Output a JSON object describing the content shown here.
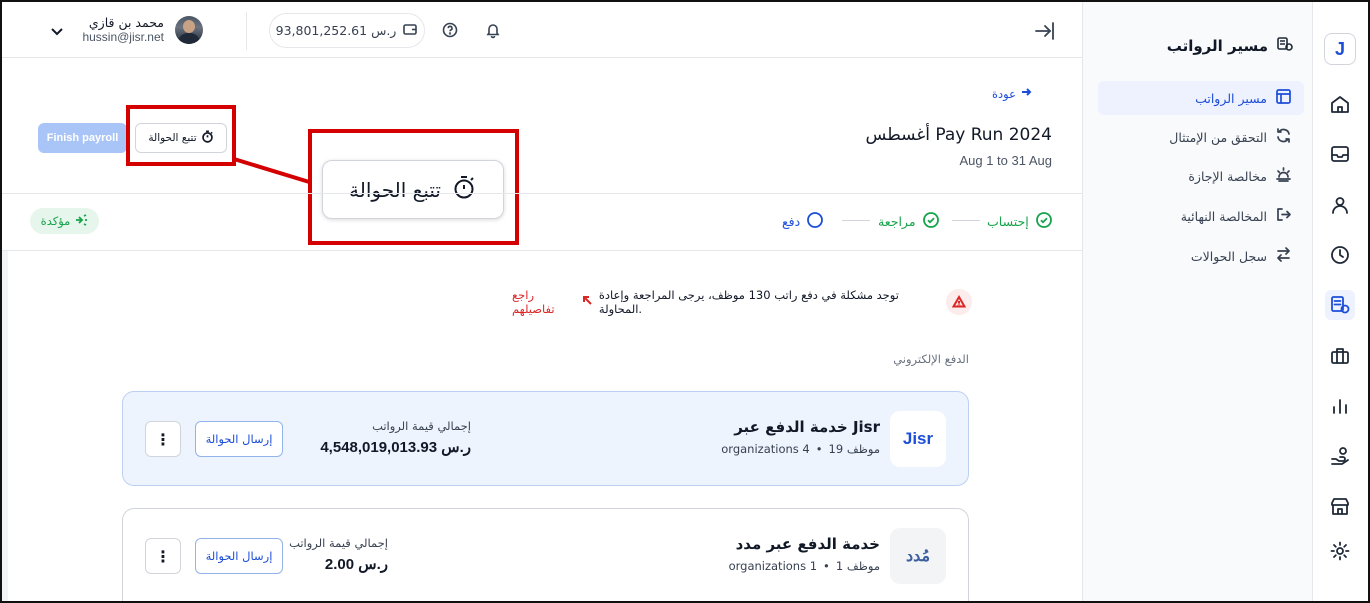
{
  "rail": {
    "logo_letter": "J"
  },
  "submenu": {
    "title": "مسير الرواتب",
    "items": [
      {
        "label": "مسير الرواتب"
      },
      {
        "label": "التحقق من الإمتثال"
      },
      {
        "label": "مخالصة الإجازة"
      },
      {
        "label": "المخالصة النهائية"
      },
      {
        "label": "سجل الحوالات"
      }
    ]
  },
  "topbar": {
    "balance": "93,801,252.61 ر.س",
    "user_name": "محمد بن قازي",
    "user_email": "hussin@jisr.net"
  },
  "header": {
    "back_label": "عودة",
    "title": "أغسطس Pay Run 2024",
    "subtitle": "Aug 1 to 31 Aug",
    "finish_label": "Finish payroll",
    "track_label": "تتبع الحوالة"
  },
  "zoom": {
    "label": "تتبع الحوالة"
  },
  "steps": [
    {
      "label": "إحتساب",
      "state": "done"
    },
    {
      "label": "مراجعة",
      "state": "done"
    },
    {
      "label": "دفع",
      "state": "pending"
    }
  ],
  "status_badge": "مؤكدة",
  "warning": {
    "text": "توجد مشكلة في دفع راتب 130 موظف، يرجى المراجعة وإعادة المحاولة.",
    "link": "راجع تفاصيلهم"
  },
  "section_label": "الدفع الإلكتروني",
  "providers": [
    {
      "logo": "Jisr",
      "name": "خدمة الدفع عبر Jisr",
      "employees": "19 موظف",
      "orgs": "organizations 4",
      "total_label": "إجمالي قيمة الرواتب",
      "total_value": "4,548,019,013.93 ر.س",
      "send_label": "إرسال الحوالة",
      "more": "⋮"
    },
    {
      "logo": "مُدد",
      "name": "خدمة الدفع عبر مدد",
      "employees": "1 موظف",
      "orgs": "organizations 1",
      "total_label": "إجمالي قيمة الرواتب",
      "total_value": "2.00 ر.س",
      "send_label": "إرسال الحوالة",
      "more": "⋮"
    }
  ],
  "colors": {
    "primary": "#1d4ed8",
    "success": "#16a34a",
    "danger": "#dc2626",
    "annotation": "#d40000"
  }
}
